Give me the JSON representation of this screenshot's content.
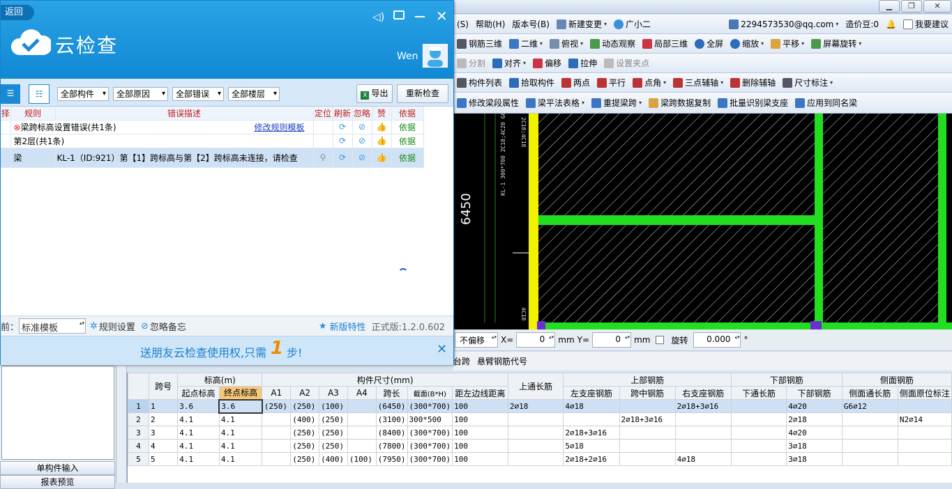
{
  "app": {
    "menu": [
      "(S)",
      "帮助(H)",
      "版本号(B)",
      "新建变更",
      "广小二"
    ],
    "account": "2294573530@qq.com",
    "cost_bean": "造价豆:0",
    "suggest": "我要建议",
    "toolbar1": [
      "钢筋三维",
      "二维",
      "俯视",
      "动态观察",
      "局部三维",
      "全屏",
      "缩放",
      "平移",
      "屏幕旋转"
    ],
    "toolbar2": [
      "分割",
      "对齐",
      "偏移",
      "拉伸",
      "设置夹点"
    ],
    "toolbar3": [
      "构件列表",
      "拾取构件",
      "两点",
      "平行",
      "点角",
      "三点辅轴",
      "删除辅轴",
      "尺寸标注"
    ],
    "toolbar4": [
      "修改梁段属性",
      "梁平法表格",
      "重提梁跨",
      "梁跨数据复制",
      "批量识别梁支座",
      "应用到同名梁"
    ]
  },
  "canvas": {
    "dimension": "6450",
    "label_top": "2C18;4C18",
    "label_mid": "KL-1 300*700 2C18;4C20 G6C12",
    "label_bot": "4C18"
  },
  "statusbar": {
    "offset": "不偏移",
    "x_label": "X=",
    "x_value": "0",
    "x_unit": "mm",
    "y_label": "Y=",
    "y_value": "0",
    "y_unit": "mm",
    "rotate_label": "旋转",
    "rotate_value": "0.000",
    "deg": "°"
  },
  "tabs": [
    "台跨",
    "悬臂钢筋代号"
  ],
  "left": {
    "btn1": "单构件输入",
    "btn2": "报表预览"
  },
  "grid": {
    "groups": {
      "elev": "标高(m)",
      "size": "构件尺寸(mm)",
      "top": "上部钢筋",
      "bottom": "下部钢筋",
      "side": "侧面钢筋"
    },
    "headers": {
      "span": "跨号",
      "start": "起点标高",
      "end": "终点标高",
      "a1": "A1",
      "a2": "A2",
      "a3": "A3",
      "a4": "A4",
      "len": "跨长",
      "sect": "截面(B*H)",
      "dist": "距左边线距离",
      "through": "上通长筋",
      "left": "左支座钢筋",
      "mid": "跨中钢筋",
      "right": "右支座钢筋",
      "bthrough": "下通长筋",
      "bot": "下部钢筋",
      "sthrough": "侧面通长筋",
      "sorig": "侧面原位标注"
    },
    "rows": [
      {
        "rn": "1",
        "span": "1",
        "start": "3.6",
        "end": "3.6",
        "a1": "(250)",
        "a2": "(250)",
        "a3": "(100)",
        "a4": "",
        "len": "(6450)",
        "sect": "(300*700)",
        "dist": "100",
        "through": "2⌀18",
        "left": "4⌀18",
        "mid": "",
        "right": "2⌀18+3⌀16",
        "bthrough": "",
        "bot": "4⌀20",
        "sthrough": "G6⌀12",
        "sorig": ""
      },
      {
        "rn": "2",
        "span": "2",
        "start": "4.1",
        "end": "4.1",
        "a1": "",
        "a2": "(400)",
        "a3": "(250)",
        "a4": "",
        "len": "(3100)",
        "sect": "300*500",
        "dist": "100",
        "through": "",
        "left": "",
        "mid": "2⌀18+3⌀16",
        "right": "",
        "bthrough": "",
        "bot": "2⌀18",
        "sthrough": "",
        "sorig": "N2⌀14"
      },
      {
        "rn": "3",
        "span": "3",
        "start": "4.1",
        "end": "4.1",
        "a1": "",
        "a2": "(250)",
        "a3": "(250)",
        "a4": "",
        "len": "(8400)",
        "sect": "(300*700)",
        "dist": "100",
        "through": "",
        "left": "2⌀18+3⌀16",
        "mid": "",
        "right": "",
        "bthrough": "",
        "bot": "4⌀20",
        "sthrough": "",
        "sorig": ""
      },
      {
        "rn": "4",
        "span": "4",
        "start": "4.1",
        "end": "4.1",
        "a1": "",
        "a2": "(250)",
        "a3": "(250)",
        "a4": "",
        "len": "(7800)",
        "sect": "(300*700)",
        "dist": "100",
        "through": "",
        "left": "5⌀18",
        "mid": "",
        "right": "",
        "bthrough": "",
        "bot": "3⌀18",
        "sthrough": "",
        "sorig": ""
      },
      {
        "rn": "5",
        "span": "5",
        "start": "4.1",
        "end": "4.1",
        "a1": "",
        "a2": "(250)",
        "a3": "(400)",
        "a4": "(100)",
        "len": "(7950)",
        "sect": "(300*700)",
        "dist": "100",
        "through": "",
        "left": "2⌀18+2⌀16",
        "mid": "",
        "right": "4⌀18",
        "bthrough": "",
        "bot": "3⌀18",
        "sthrough": "",
        "sorig": ""
      }
    ]
  },
  "dialog": {
    "back": "返回",
    "title": "云检查",
    "user": "Wen",
    "filters": [
      "全部构件",
      "全部原因",
      "全部错误",
      "全部楼层"
    ],
    "export": "导出",
    "recheck": "重新检查",
    "cols": {
      "c0": "择",
      "rule": "规则",
      "desc": "错误描述",
      "loc": "定位",
      "refresh": "刷新",
      "ignore": "忽略",
      "like": "赞",
      "basis": "依据"
    },
    "rows": [
      {
        "rule": "梁跨标高设置错误(共1条)",
        "desc": "",
        "link": "修改规则模板",
        "basis": "依据"
      },
      {
        "rule": "第2层(共1条)",
        "desc": "",
        "link": "",
        "basis": "依据"
      },
      {
        "rule": "梁",
        "desc": "KL-1（ID:921）第【1】跨标高与第【2】跨标高未连接，请检查",
        "link": "",
        "basis": "依据"
      }
    ],
    "template_label": "前：",
    "template": "标准模板",
    "rule_settings": "规则设置",
    "ignore_memo": "忽略备忘",
    "new_features": "新版特性",
    "version": "正式版:1.2.0.602",
    "promo_a": "送朋友云检查使用权,只需",
    "promo_num": "1",
    "promo_b": "步!"
  }
}
